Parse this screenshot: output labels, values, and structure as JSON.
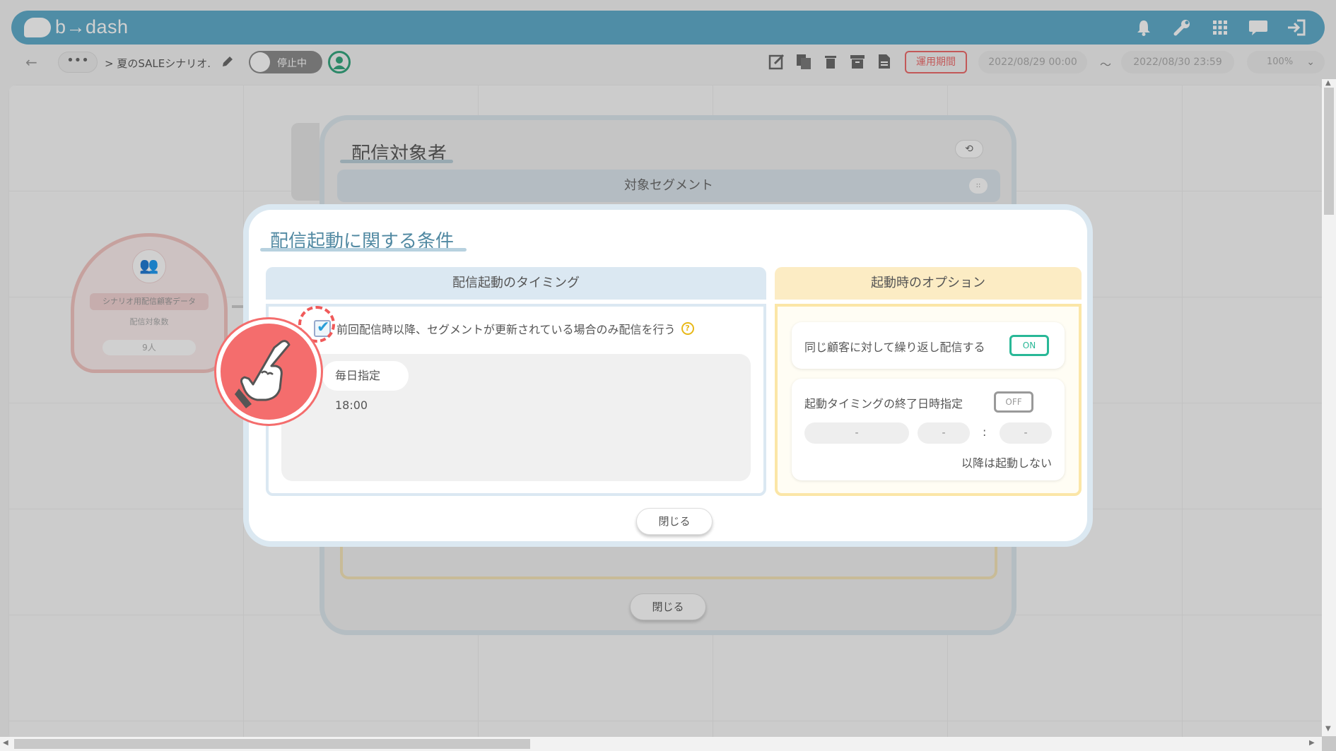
{
  "app": {
    "logo_text": "b→dash",
    "brand_color": "#5aa9c9"
  },
  "topbar": {
    "icons": [
      "bell-icon",
      "wrench-icon",
      "grid-icon",
      "chat-icon",
      "logout-icon"
    ]
  },
  "toolbar": {
    "back_arrow": "←",
    "more": "•••",
    "breadcrumb": "> 夏のSALEシナリオ.",
    "status_toggle": "停止中",
    "period_button": "運用期間",
    "start_datetime": "2022/08/29 00:00",
    "tilde": "〜",
    "end_datetime": "2022/08/30 23:59",
    "zoom": "100%",
    "zoom_chevron": "⌄"
  },
  "canvas": {
    "node": {
      "icon": "👥",
      "title": "シナリオ用配信顧客データ",
      "count_label": "配信対象数",
      "count_value": "9人"
    }
  },
  "back_modal": {
    "title": "配信対象者",
    "history_icon": "⟲",
    "segment_bar": "対象セグメント",
    "segment_dots": "::",
    "close_label": "閉じる"
  },
  "modal": {
    "title": "配信起動に関する条件",
    "timing_header": "配信起動のタイミング",
    "options_header": "起動時のオプション",
    "checkbox_checked": true,
    "checkbox_mark": "✔",
    "checkbox_label": "前回配信時以降、セグメントが更新されている場合のみ配信を行う",
    "help_mark": "?",
    "schedule_chip": "毎日指定 18:00",
    "repeat_label": "同じ顧客に対して繰り返し配信する",
    "repeat_switch": "ON",
    "end_label": "起動タイミングの終了日時指定",
    "end_switch": "OFF",
    "end_date": "-",
    "end_hour": "-",
    "end_minute": "-",
    "colon": ":",
    "after_note": "以降は起動しない",
    "close_label": "閉じる",
    "accent_colors": {
      "on": "#29b897",
      "title": "#5189a2",
      "options": "#fbe6a7",
      "timing": "#dbe8f2"
    }
  },
  "tutorial": {
    "pointer_icon": "hand-pointer-icon",
    "ring_color": "#f46d6d"
  },
  "scroll": {
    "up": "▲",
    "down": "▼",
    "left": "◀",
    "right": "▶"
  }
}
